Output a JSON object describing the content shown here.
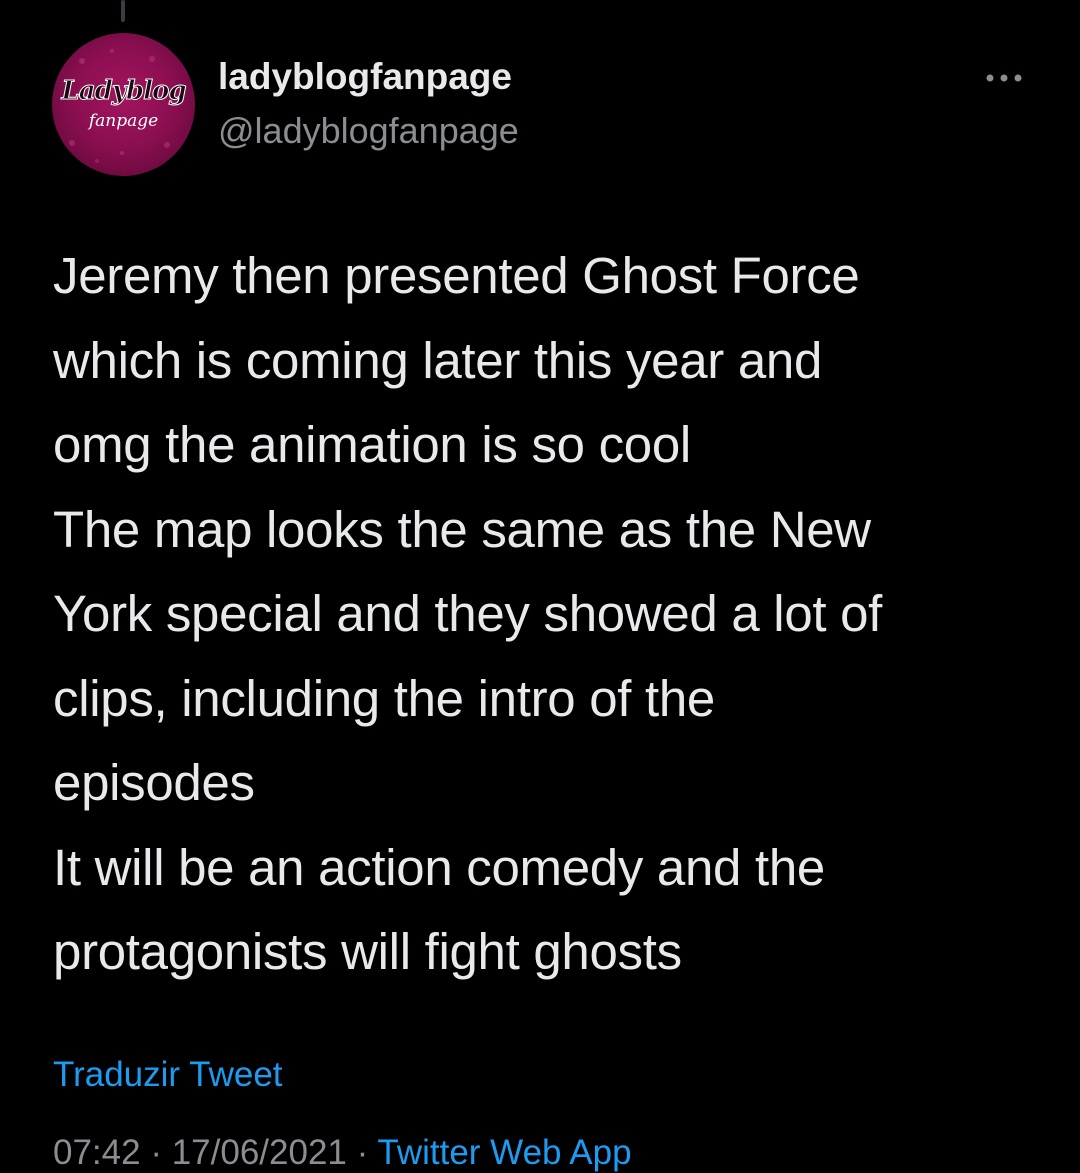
{
  "colors": {
    "background": "#000000",
    "text": "#e7e9ea",
    "secondary_text": "#8a8d91",
    "link": "#1d9bf0",
    "avatar_bg": "#8c0f52"
  },
  "author": {
    "avatar_logo_line1": "Ladyblog",
    "avatar_logo_line2": "fanpage",
    "display_name": "ladyblogfanpage",
    "handle": "@ladyblogfanpage"
  },
  "more_icon": "more-horizontal-icon",
  "tweet": {
    "lines": [
      "Jeremy then presented Ghost Force",
      "which is coming later this year and",
      "omg the animation is so cool",
      "The map looks the same as the New",
      "York special and they showed a lot of",
      "clips, including the intro of the",
      "episodes",
      "It will be an action comedy and the",
      "protagonists will fight ghosts"
    ],
    "translate_label": "Traduzir Tweet",
    "meta": {
      "time": "07:42",
      "separator": "·",
      "date": "17/06/2021",
      "source": "Twitter Web App"
    }
  }
}
